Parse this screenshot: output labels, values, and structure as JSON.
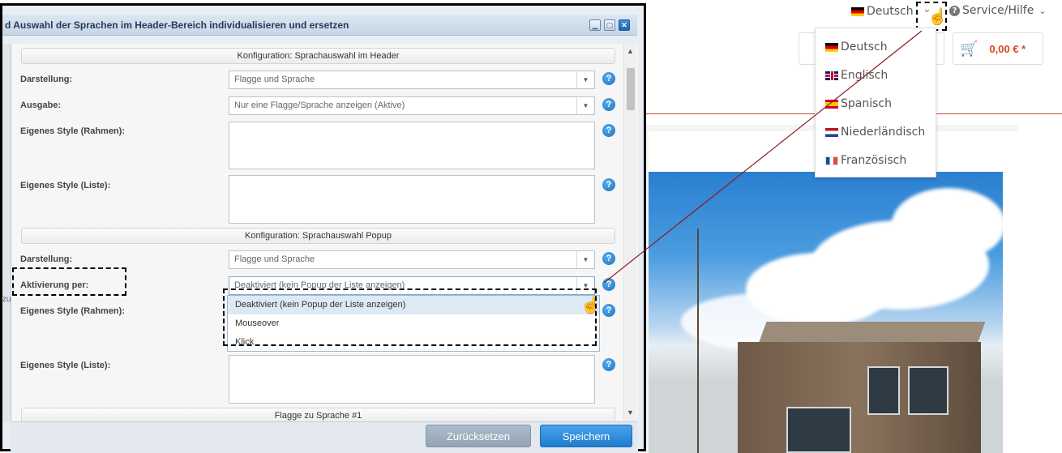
{
  "shop": {
    "language_current": "Deutsch",
    "service_label": "Service/Hilfe",
    "cart_amount": "0,00 € *",
    "language_options": [
      {
        "label": "Deutsch",
        "flag": "de"
      },
      {
        "label": "Englisch",
        "flag": "en"
      },
      {
        "label": "Spanisch",
        "flag": "es"
      },
      {
        "label": "Niederländisch",
        "flag": "nl"
      },
      {
        "label": "Französisch",
        "flag": "fr"
      }
    ],
    "accent_color": "#d9481c"
  },
  "modal": {
    "title": "d Auswahl der Sprachen im Header-Bereich individualisieren und ersetzen",
    "sections": {
      "header": "Konfiguration: Sprachauswahl im Header",
      "popup": "Konfiguration: Sprachauswahl Popup",
      "flag1": "Flagge zu Sprache #1"
    },
    "header_fields": {
      "darstellung_label": "Darstellung:",
      "darstellung_value": "Flagge und Sprache",
      "ausgabe_label": "Ausgabe:",
      "ausgabe_value": "Nur eine Flagge/Sprache anzeigen (Aktive)",
      "style_rahmen_label": "Eigenes Style (Rahmen):",
      "style_liste_label": "Eigenes Style (Liste):"
    },
    "popup_fields": {
      "darstellung_label": "Darstellung:",
      "darstellung_value": "Flagge und Sprache",
      "aktivierung_label": "Aktivierung per:",
      "aktivierung_value": "Deaktiviert (kein Popup der Liste anzeigen)",
      "style_rahmen_label": "Eigenes Style (Rahmen):",
      "style_liste_label": "Eigenes Style (Liste):"
    },
    "aktivierung_options": [
      "Deaktiviert (kein Popup der Liste anzeigen)",
      "Mouseover",
      "Klick"
    ],
    "left_strip_text": "zu",
    "help_glyph": "?",
    "buttons": {
      "reset": "Zurücksetzen",
      "save": "Speichern"
    }
  }
}
